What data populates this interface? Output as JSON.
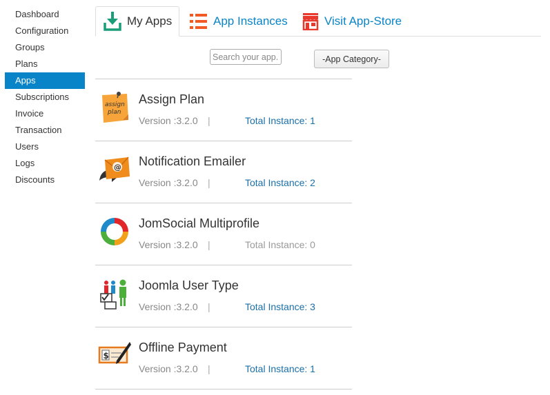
{
  "sidebar": {
    "items": [
      {
        "label": "Dashboard"
      },
      {
        "label": "Configuration"
      },
      {
        "label": "Groups"
      },
      {
        "label": "Plans"
      },
      {
        "label": "Apps",
        "active": true
      },
      {
        "label": "Subscriptions"
      },
      {
        "label": "Invoice"
      },
      {
        "label": "Transaction"
      },
      {
        "label": "Users"
      },
      {
        "label": "Logs"
      },
      {
        "label": "Discounts"
      }
    ]
  },
  "tabs": {
    "my_apps": {
      "label": "My Apps",
      "icon": "download-icon",
      "color": "#1a9e7a"
    },
    "instances": {
      "label": "App Instances",
      "icon": "list-icon",
      "color": "#f15a24"
    },
    "store": {
      "label": "Visit App-Store",
      "icon": "store-icon",
      "color": "#e8392c"
    }
  },
  "filters": {
    "search_placeholder": "Search your app..",
    "category_label": "-App Category-"
  },
  "colors": {
    "accent": "#0a84c8",
    "link": "#1a6fa8"
  },
  "apps": [
    {
      "name": "Assign Plan",
      "version": "Version :3.2.0",
      "separator": "|",
      "instances": "Total Instance: 1",
      "icon": "sticky-note-icon"
    },
    {
      "name": "Notification Emailer",
      "version": "Version :3.2.0",
      "separator": "|",
      "instances": "Total Instance: 2",
      "icon": "email-envelope-icon"
    },
    {
      "name": "JomSocial Multiprofile",
      "version": "Version :3.2.0",
      "separator": "|",
      "instances": "Total Instance: 0",
      "icon": "jomsocial-swirl-icon"
    },
    {
      "name": "Joomla User Type",
      "version": "Version :3.2.0",
      "separator": "|",
      "instances": "Total Instance: 3",
      "icon": "user-types-icon"
    },
    {
      "name": "Offline Payment",
      "version": "Version :3.2.0",
      "separator": "|",
      "instances": "Total Instance: 1",
      "icon": "cheque-pen-icon"
    }
  ]
}
